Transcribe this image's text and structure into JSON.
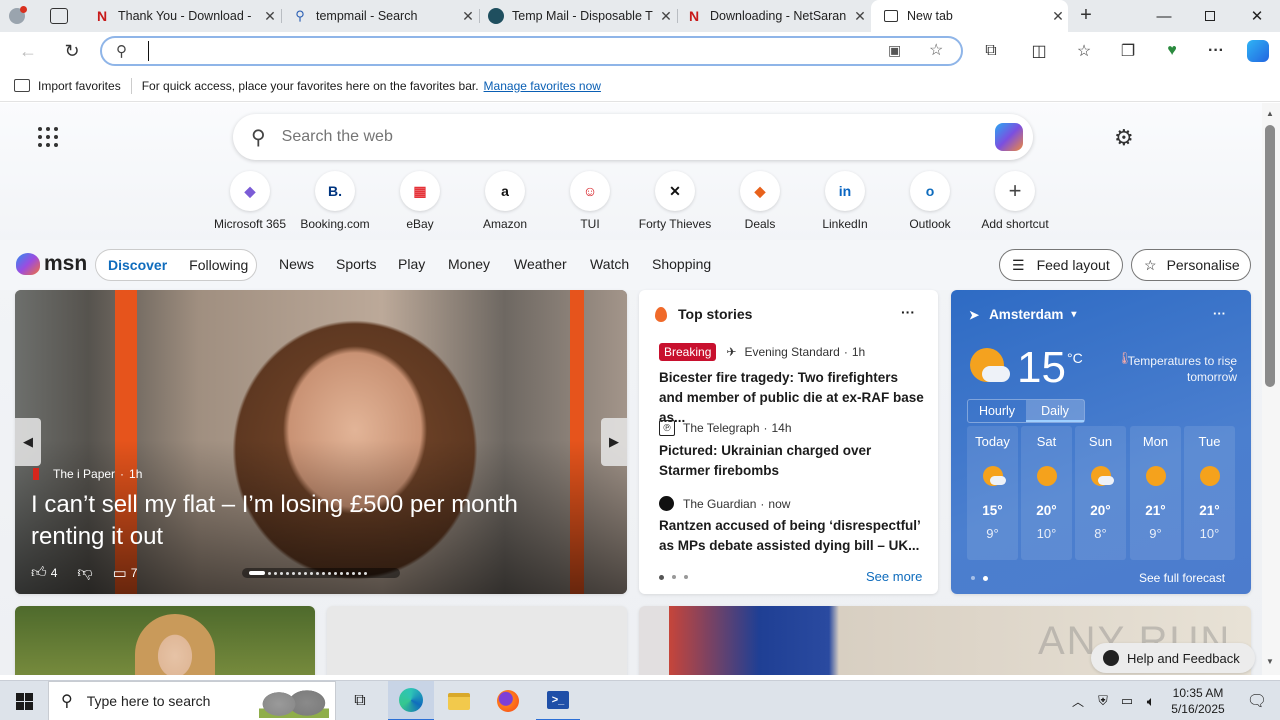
{
  "tabs": [
    {
      "title": "Thank You - Download -",
      "icon": "netsarang-icon"
    },
    {
      "title": "tempmail - Search",
      "icon": "bing-search-icon"
    },
    {
      "title": "Temp Mail - Disposable T",
      "icon": "tempmail-icon"
    },
    {
      "title": "Downloading - NetSaran",
      "icon": "netsarang-icon"
    },
    {
      "title": "New tab",
      "icon": "newtab-icon",
      "active": true
    }
  ],
  "address": {
    "value": ""
  },
  "favbar": {
    "import": "Import favorites",
    "hint": "For quick access, place your favorites here on the favorites bar.",
    "manage": "Manage favorites now"
  },
  "search": {
    "placeholder": "Search the web"
  },
  "shortcuts": [
    {
      "label": "Microsoft 365",
      "glyph": "◆",
      "color": "#7b5cd6"
    },
    {
      "label": "Booking.com",
      "glyph": "B.",
      "color": "#003580"
    },
    {
      "label": "eBay",
      "glyph": "▦",
      "color": "#e53238"
    },
    {
      "label": "Amazon",
      "glyph": "a",
      "color": "#111"
    },
    {
      "label": "TUI",
      "glyph": "☺",
      "color": "#d40e14"
    },
    {
      "label": "Forty Thieves",
      "glyph": "✕",
      "color": "#111"
    },
    {
      "label": "Deals",
      "glyph": "◆",
      "color": "#e8621c"
    },
    {
      "label": "LinkedIn",
      "glyph": "in",
      "color": "#0a66c2"
    },
    {
      "label": "Outlook",
      "glyph": "o",
      "color": "#0f6cbd"
    },
    {
      "label": "Add shortcut",
      "glyph": "+",
      "color": "#444"
    }
  ],
  "msn": {
    "brand": "msn",
    "tabs": [
      "Discover",
      "Following"
    ],
    "nav": [
      "News",
      "Sports",
      "Play",
      "Money",
      "Weather",
      "Watch",
      "Shopping"
    ],
    "feed_layout": "Feed layout",
    "personalise": "Personalise"
  },
  "hero": {
    "source": "The i Paper",
    "age": "1h",
    "headline": "I can’t sell my flat – I’m losing £500 per month renting it out",
    "likes": "4",
    "comments": "7"
  },
  "top_stories": {
    "title": "Top stories",
    "items": [
      {
        "badge": "Breaking",
        "source": "Evening Standard",
        "age": "1h",
        "headline": "Bicester fire tragedy: Two firefighters and member of public die at ex-RAF base as..."
      },
      {
        "source": "The Telegraph",
        "age": "14h",
        "headline": "Pictured: Ukrainian charged over Starmer firebombs"
      },
      {
        "source": "The Guardian",
        "age": "now",
        "headline": "Rantzen accused of being ‘disrespectful’ as MPs debate assisted dying bill – UK..."
      }
    ],
    "see_more": "See more"
  },
  "weather": {
    "city": "Amsterdam",
    "temp": "15",
    "unit": "°C",
    "note": "Temperatures to rise tomorrow",
    "modes": [
      "Hourly",
      "Daily"
    ],
    "days": [
      {
        "name": "Today",
        "hi": "15°",
        "lo": "9°",
        "icon": "partly-cloudy-icon"
      },
      {
        "name": "Sat",
        "hi": "20°",
        "lo": "10°",
        "icon": "sun-icon"
      },
      {
        "name": "Sun",
        "hi": "20°",
        "lo": "8°",
        "icon": "partly-cloudy-icon"
      },
      {
        "name": "Mon",
        "hi": "21°",
        "lo": "9°",
        "icon": "sun-icon"
      },
      {
        "name": "Tue",
        "hi": "21°",
        "lo": "10°",
        "icon": "sun-icon"
      }
    ],
    "full_forecast": "See full forecast"
  },
  "help": "Help and Feedback",
  "watermark": "ANY RUN",
  "taskbar": {
    "search_placeholder": "Type here to search",
    "time": "10:35 AM",
    "date": "5/16/2025"
  }
}
